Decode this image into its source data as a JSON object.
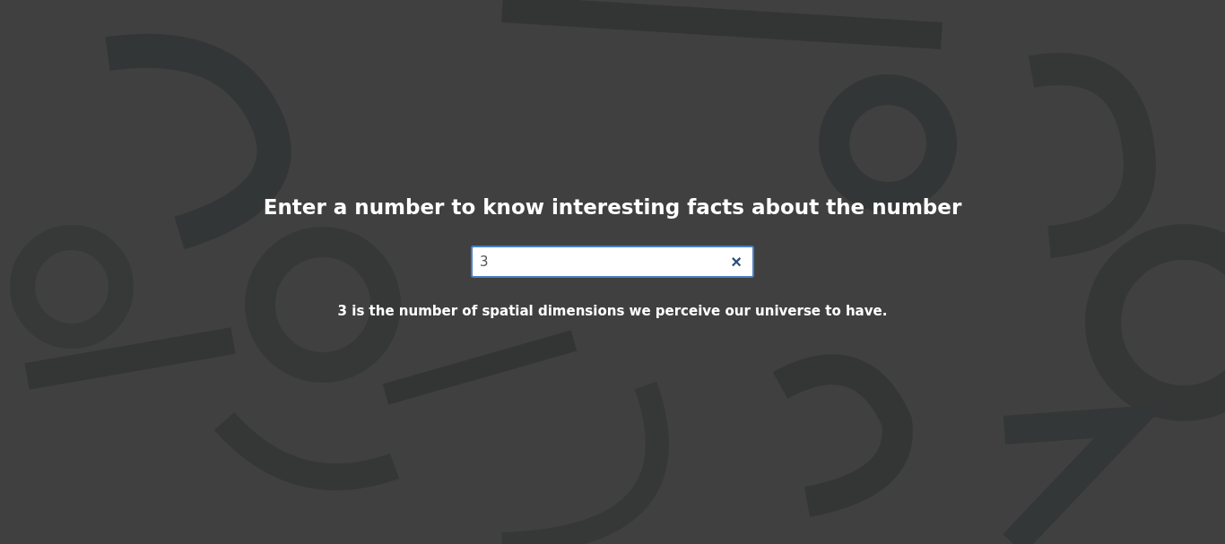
{
  "heading": "Enter a number to know interesting facts about the number",
  "search": {
    "value": "3",
    "clear": "×"
  },
  "fact": "3 is the number of spatial dimensions we perceive our universe to have."
}
